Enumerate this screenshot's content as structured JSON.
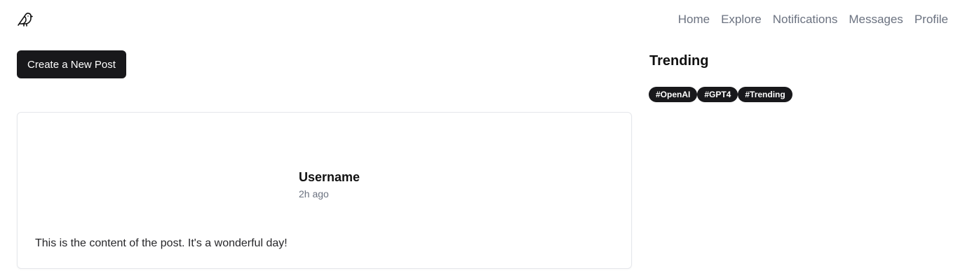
{
  "header": {
    "logo_icon": "bird-icon",
    "nav": [
      {
        "label": "Home"
      },
      {
        "label": "Explore"
      },
      {
        "label": "Notifications"
      },
      {
        "label": "Messages"
      },
      {
        "label": "Profile"
      }
    ]
  },
  "main": {
    "create_button_label": "Create a New Post",
    "post": {
      "username": "Username",
      "time": "2h ago",
      "content": "This is the content of the post. It's a wonderful day!"
    }
  },
  "sidebar": {
    "title": "Trending",
    "tags": [
      "#OpenAI",
      "#GPT4",
      "#Trending"
    ]
  },
  "colors": {
    "primary_dark": "#18181b",
    "nav_gray": "#6b7280",
    "border": "#e5e7eb"
  }
}
